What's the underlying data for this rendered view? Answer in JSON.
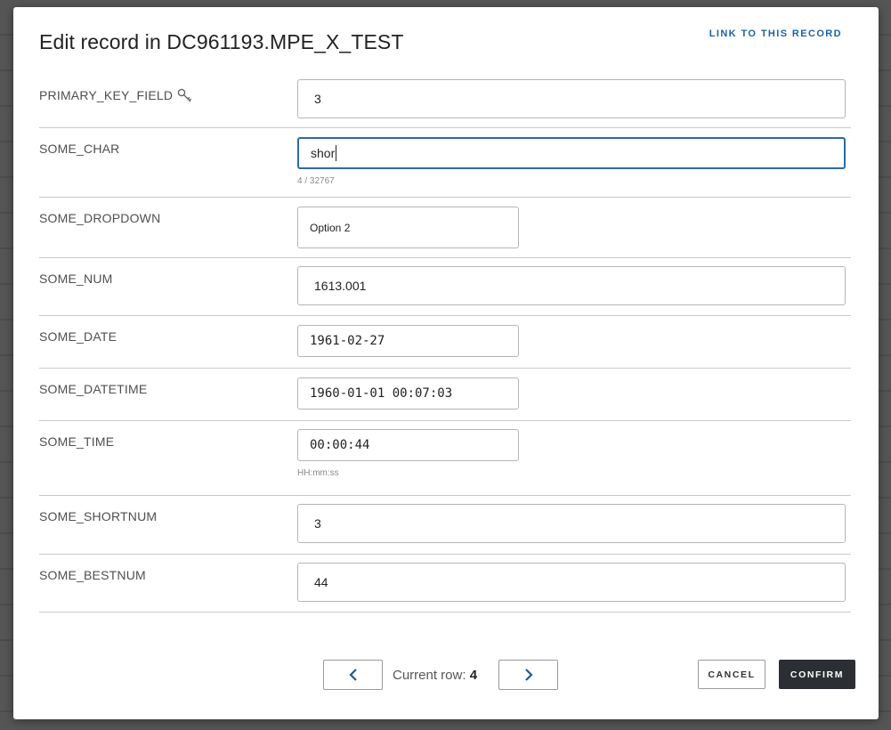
{
  "modal": {
    "title": "Edit record in DC961193.MPE_X_TEST",
    "link_label": "LINK TO THIS RECORD"
  },
  "fields": [
    {
      "label": "PRIMARY_KEY_FIELD",
      "value": "3",
      "icon": "key-icon"
    },
    {
      "label": "SOME_CHAR",
      "value": "shor",
      "hint": "4 / 32767"
    },
    {
      "label": "SOME_DROPDOWN",
      "value": "Option 2"
    },
    {
      "label": "SOME_NUM",
      "value": "1613.001"
    },
    {
      "label": "SOME_DATE",
      "value": "1961-02-27"
    },
    {
      "label": "SOME_DATETIME",
      "value": "1960-01-01 00:07:03"
    },
    {
      "label": "SOME_TIME",
      "value": "00:00:44",
      "hint": "HH:mm:ss"
    },
    {
      "label": "SOME_SHORTNUM",
      "value": "3"
    },
    {
      "label": "SOME_BESTNUM",
      "value": "44"
    }
  ],
  "footer": {
    "current_row_label": "Current row:",
    "current_row_value": "4",
    "prev_icon": "chevron-left-icon",
    "next_icon": "chevron-right-icon",
    "cancel_label": "CANCEL",
    "confirm_label": "CONFIRM"
  },
  "colors": {
    "accent": "#1a63a8",
    "focus_border": "#2d6aa8",
    "confirm_bg": "#2b2f33"
  }
}
